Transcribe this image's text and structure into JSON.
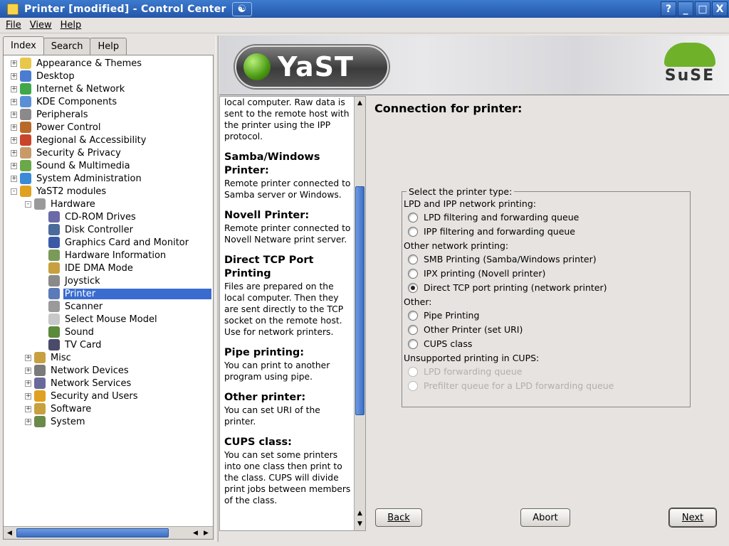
{
  "window": {
    "title": "Printer [modified] - Control Center",
    "help_btn": "?",
    "min_btn": "_",
    "max_btn": "□",
    "close_btn": "X"
  },
  "menu": {
    "file": "File",
    "view": "View",
    "help": "Help"
  },
  "tabs": [
    {
      "label": "Index",
      "active": true
    },
    {
      "label": "Search",
      "active": false
    },
    {
      "label": "Help",
      "active": false
    }
  ],
  "tree": [
    {
      "label": "Appearance & Themes",
      "level": 0,
      "expander": "+"
    },
    {
      "label": "Desktop",
      "level": 0,
      "expander": "+"
    },
    {
      "label": "Internet & Network",
      "level": 0,
      "expander": "+"
    },
    {
      "label": "KDE Components",
      "level": 0,
      "expander": "+"
    },
    {
      "label": "Peripherals",
      "level": 0,
      "expander": "+"
    },
    {
      "label": "Power Control",
      "level": 0,
      "expander": "+"
    },
    {
      "label": "Regional & Accessibility",
      "level": 0,
      "expander": "+"
    },
    {
      "label": "Security & Privacy",
      "level": 0,
      "expander": "+"
    },
    {
      "label": "Sound & Multimedia",
      "level": 0,
      "expander": "+"
    },
    {
      "label": "System Administration",
      "level": 0,
      "expander": "+"
    },
    {
      "label": "YaST2 modules",
      "level": 0,
      "expander": "-"
    },
    {
      "label": "Hardware",
      "level": 1,
      "expander": "-"
    },
    {
      "label": "CD-ROM Drives",
      "level": 2,
      "expander": ""
    },
    {
      "label": "Disk Controller",
      "level": 2,
      "expander": ""
    },
    {
      "label": "Graphics Card and Monitor",
      "level": 2,
      "expander": ""
    },
    {
      "label": "Hardware Information",
      "level": 2,
      "expander": ""
    },
    {
      "label": "IDE DMA Mode",
      "level": 2,
      "expander": ""
    },
    {
      "label": "Joystick",
      "level": 2,
      "expander": ""
    },
    {
      "label": "Printer",
      "level": 2,
      "expander": "",
      "selected": true
    },
    {
      "label": "Scanner",
      "level": 2,
      "expander": ""
    },
    {
      "label": "Select Mouse Model",
      "level": 2,
      "expander": ""
    },
    {
      "label": "Sound",
      "level": 2,
      "expander": ""
    },
    {
      "label": "TV Card",
      "level": 2,
      "expander": ""
    },
    {
      "label": "Misc",
      "level": 1,
      "expander": "+"
    },
    {
      "label": "Network Devices",
      "level": 1,
      "expander": "+"
    },
    {
      "label": "Network Services",
      "level": 1,
      "expander": "+"
    },
    {
      "label": "Security and Users",
      "level": 1,
      "expander": "+"
    },
    {
      "label": "Software",
      "level": 1,
      "expander": "+"
    },
    {
      "label": "System",
      "level": 1,
      "expander": "+"
    }
  ],
  "banner": {
    "yast": "YaST",
    "suse": "SuSE"
  },
  "help": {
    "intro": "local computer. Raw data is sent to the remote host with the printer using the IPP protocol.",
    "sections": [
      {
        "title": "Samba/Windows Printer:",
        "text": "Remote printer connected to Samba server or Windows."
      },
      {
        "title": "Novell Printer:",
        "text": "Remote printer connected to Novell Netware print server."
      },
      {
        "title": "Direct TCP Port Printing",
        "text": "Files are prepared on the local computer. Then they are sent directly to the TCP socket on the remote host. Use for network printers."
      },
      {
        "title": "Pipe printing:",
        "text": "You can print to another program using pipe."
      },
      {
        "title": "Other printer:",
        "text": "You can set URI of the printer."
      },
      {
        "title": "CUPS class:",
        "text": "You can set some printers into one class then print to the class. CUPS will divide print jobs between members of the class."
      }
    ]
  },
  "content": {
    "title": "Connection for printer:",
    "group_label": "Select the printer type:",
    "sections": [
      {
        "label": "LPD and IPP network printing:"
      },
      {
        "label": "Other network printing:"
      },
      {
        "label": "Other:"
      },
      {
        "label": "Unsupported printing in CUPS:"
      }
    ],
    "options": [
      {
        "label": "LPD filtering and forwarding queue",
        "checked": false,
        "disabled": false
      },
      {
        "label": "IPP filtering and forwarding queue",
        "checked": false,
        "disabled": false
      },
      {
        "label": "SMB Printing (Samba/Windows printer)",
        "checked": false,
        "disabled": false
      },
      {
        "label": "IPX printing (Novell printer)",
        "checked": false,
        "disabled": false
      },
      {
        "label": "Direct TCP port printing (network printer)",
        "checked": true,
        "disabled": false
      },
      {
        "label": "Pipe Printing",
        "checked": false,
        "disabled": false
      },
      {
        "label": "Other Printer (set URI)",
        "checked": false,
        "disabled": false
      },
      {
        "label": "CUPS class",
        "checked": false,
        "disabled": false
      },
      {
        "label": "LPD forwarding queue",
        "checked": false,
        "disabled": true
      },
      {
        "label": "Prefilter queue for a LPD forwarding queue",
        "checked": false,
        "disabled": true
      }
    ]
  },
  "buttons": {
    "back": "Back",
    "abort": "Abort",
    "next": "Next"
  },
  "colors": {
    "titlebar": "#2e66b8",
    "selection": "#3a6ccf",
    "background": "#e6e3e0"
  }
}
